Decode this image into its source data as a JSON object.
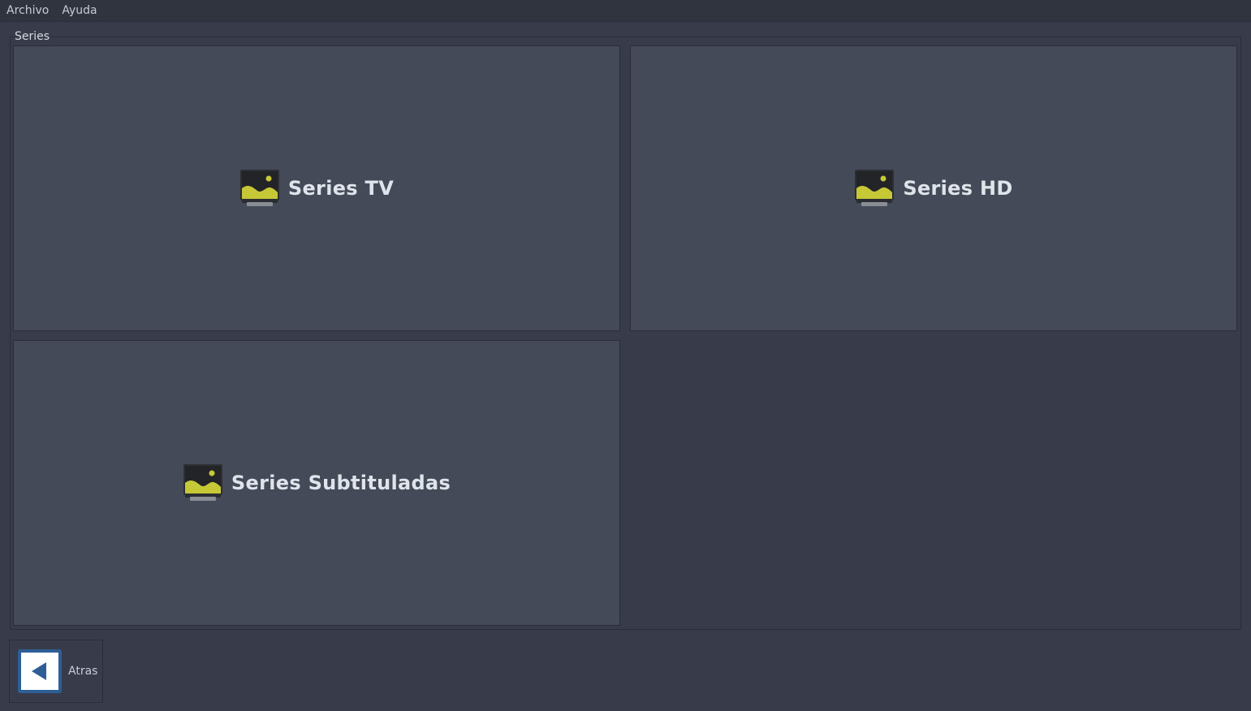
{
  "menubar": {
    "items": [
      {
        "label": "Archivo"
      },
      {
        "label": "Ayuda"
      }
    ]
  },
  "group": {
    "title": "Series"
  },
  "tiles": [
    {
      "label": "Series TV",
      "icon": "image-icon"
    },
    {
      "label": "Series HD",
      "icon": "image-icon"
    },
    {
      "label": "Series Subtituladas",
      "icon": "image-icon"
    }
  ],
  "footer": {
    "back_label": "Atras",
    "back_icon": "back-arrow-icon"
  },
  "colors": {
    "background": "#383c4a",
    "tile": "#444a58",
    "accent_blue": "#2d5f96",
    "icon_yellow": "#c6c935"
  }
}
